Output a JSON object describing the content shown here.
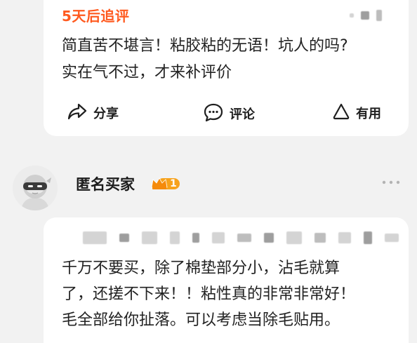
{
  "review_followup": {
    "title": "5天后追评",
    "text_line1": "简直苦不堪言！粘胶粘的无语！坑人的吗?",
    "text_line2": "实在气不过，才来补评价",
    "actions": {
      "share_label": "分享",
      "comment_label": "评论",
      "useful_label": "有用"
    }
  },
  "review2": {
    "username": "匿名买家",
    "level": "1",
    "text_line1": "千万不要买，除了棉垫部分小，沾毛就算",
    "text_line2": "了，还搓不下来！！粘性真的非常非常好！",
    "text_line3": "毛全部给你扯落。可以考虑当除毛贴用。"
  },
  "colors": {
    "accent_orange": "#ff5a1f",
    "badge_gold": "#f7a21b",
    "text_main": "#222222",
    "background": "#f2f2f2"
  },
  "icons": {
    "share": "share-arrow-icon",
    "comment": "chat-bubble-icon",
    "useful": "triangle-icon",
    "more": "more-dots-icon",
    "avatar": "anonymous-ninja-avatar",
    "badge": "crown-level-badge"
  }
}
